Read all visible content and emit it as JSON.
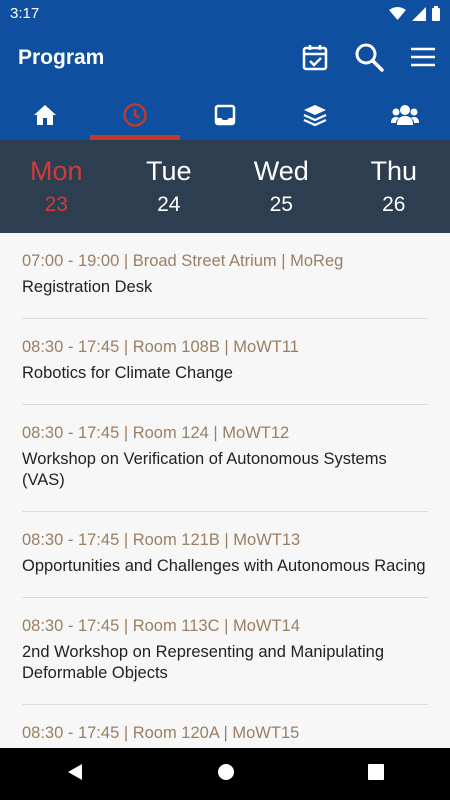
{
  "status_bar": {
    "time": "3:17"
  },
  "app_bar": {
    "title": "Program"
  },
  "tabs": [
    {
      "icon": "home-icon",
      "active": false
    },
    {
      "icon": "clock-icon",
      "active": true
    },
    {
      "icon": "inbox-icon",
      "active": false
    },
    {
      "icon": "layers-icon",
      "active": false
    },
    {
      "icon": "people-icon",
      "active": false
    }
  ],
  "days": [
    {
      "name": "Mon",
      "date": "23",
      "active": true
    },
    {
      "name": "Tue",
      "date": "24",
      "active": false
    },
    {
      "name": "Wed",
      "date": "25",
      "active": false
    },
    {
      "name": "Thu",
      "date": "26",
      "active": false
    }
  ],
  "sessions": [
    {
      "meta": "07:00 - 19:00 | Broad Street Atrium | MoReg",
      "title": "Registration Desk"
    },
    {
      "meta": "08:30 - 17:45 | Room 108B | MoWT11",
      "title": "Robotics for Climate Change"
    },
    {
      "meta": "08:30 - 17:45 | Room 124 | MoWT12",
      "title": "Workshop on Verification of Autonomous Systems (VAS)"
    },
    {
      "meta": "08:30 - 17:45 | Room 121B | MoWT13",
      "title": "Opportunities and Challenges with Autonomous Racing"
    },
    {
      "meta": "08:30 - 17:45 | Room 113C | MoWT14",
      "title": "2nd Workshop on Representing and Manipulating Deformable Objects"
    },
    {
      "meta": "08:30 - 17:45 | Room 120A | MoWT15",
      "title": ""
    }
  ],
  "colors": {
    "primary": "#0e4fa0",
    "day_bar": "#2c3e50",
    "accent": "#c0392b",
    "meta_text": "#9a7f63"
  }
}
